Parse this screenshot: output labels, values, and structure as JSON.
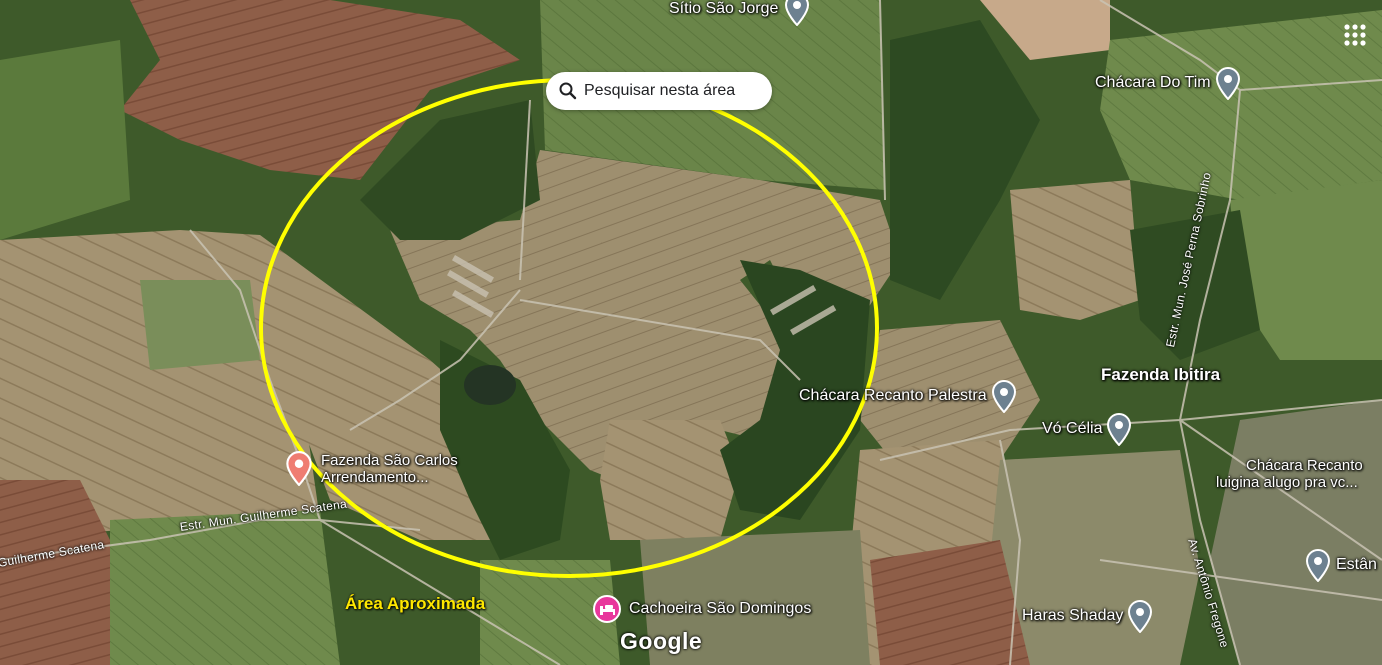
{
  "search": {
    "label": "Pesquisar nesta área"
  },
  "places": {
    "sitio_sao_jorge": "Sítio São Jorge",
    "chacara_do_tim": "Chácara Do Tim",
    "fazenda_ibitira": "Fazenda Ibitira",
    "chacara_recanto_palestra": "Chácara Recanto Palestra",
    "vo_celia": "Vó Célia",
    "chacara_recanto_line1": "Chácara Recanto",
    "chacara_recanto_line2": "luigina alugo pra vc...",
    "fazenda_sao_carlos_line1": "Fazenda São Carlos",
    "fazenda_sao_carlos_line2": "Arrendamento...",
    "cachoeira_sao_domingos": "Cachoeira São Domingos",
    "haras_shaday": "Haras Shaday",
    "estan": "Estân"
  },
  "roads": {
    "jose_perna": "Estr. Mun. José Perna Sobrinho",
    "guilherme_scatena": "Estr. Mun. Guilherme Scatena",
    "guilherme_scatena_left": "Guilherme Scatena",
    "antonio_fregone": "Av. Antônio Fregone"
  },
  "annotation": {
    "area_label": "Área Aproximada",
    "circle_color": "#ffff00"
  },
  "brand": {
    "logo": "Google"
  },
  "icons": {
    "search": "search-icon",
    "apps": "apps-grid-icon",
    "place_pin": "gray-place-pin-icon",
    "hotel_pin": "pink-hotel-pin-icon",
    "red_pin": "red-place-pin-icon"
  }
}
